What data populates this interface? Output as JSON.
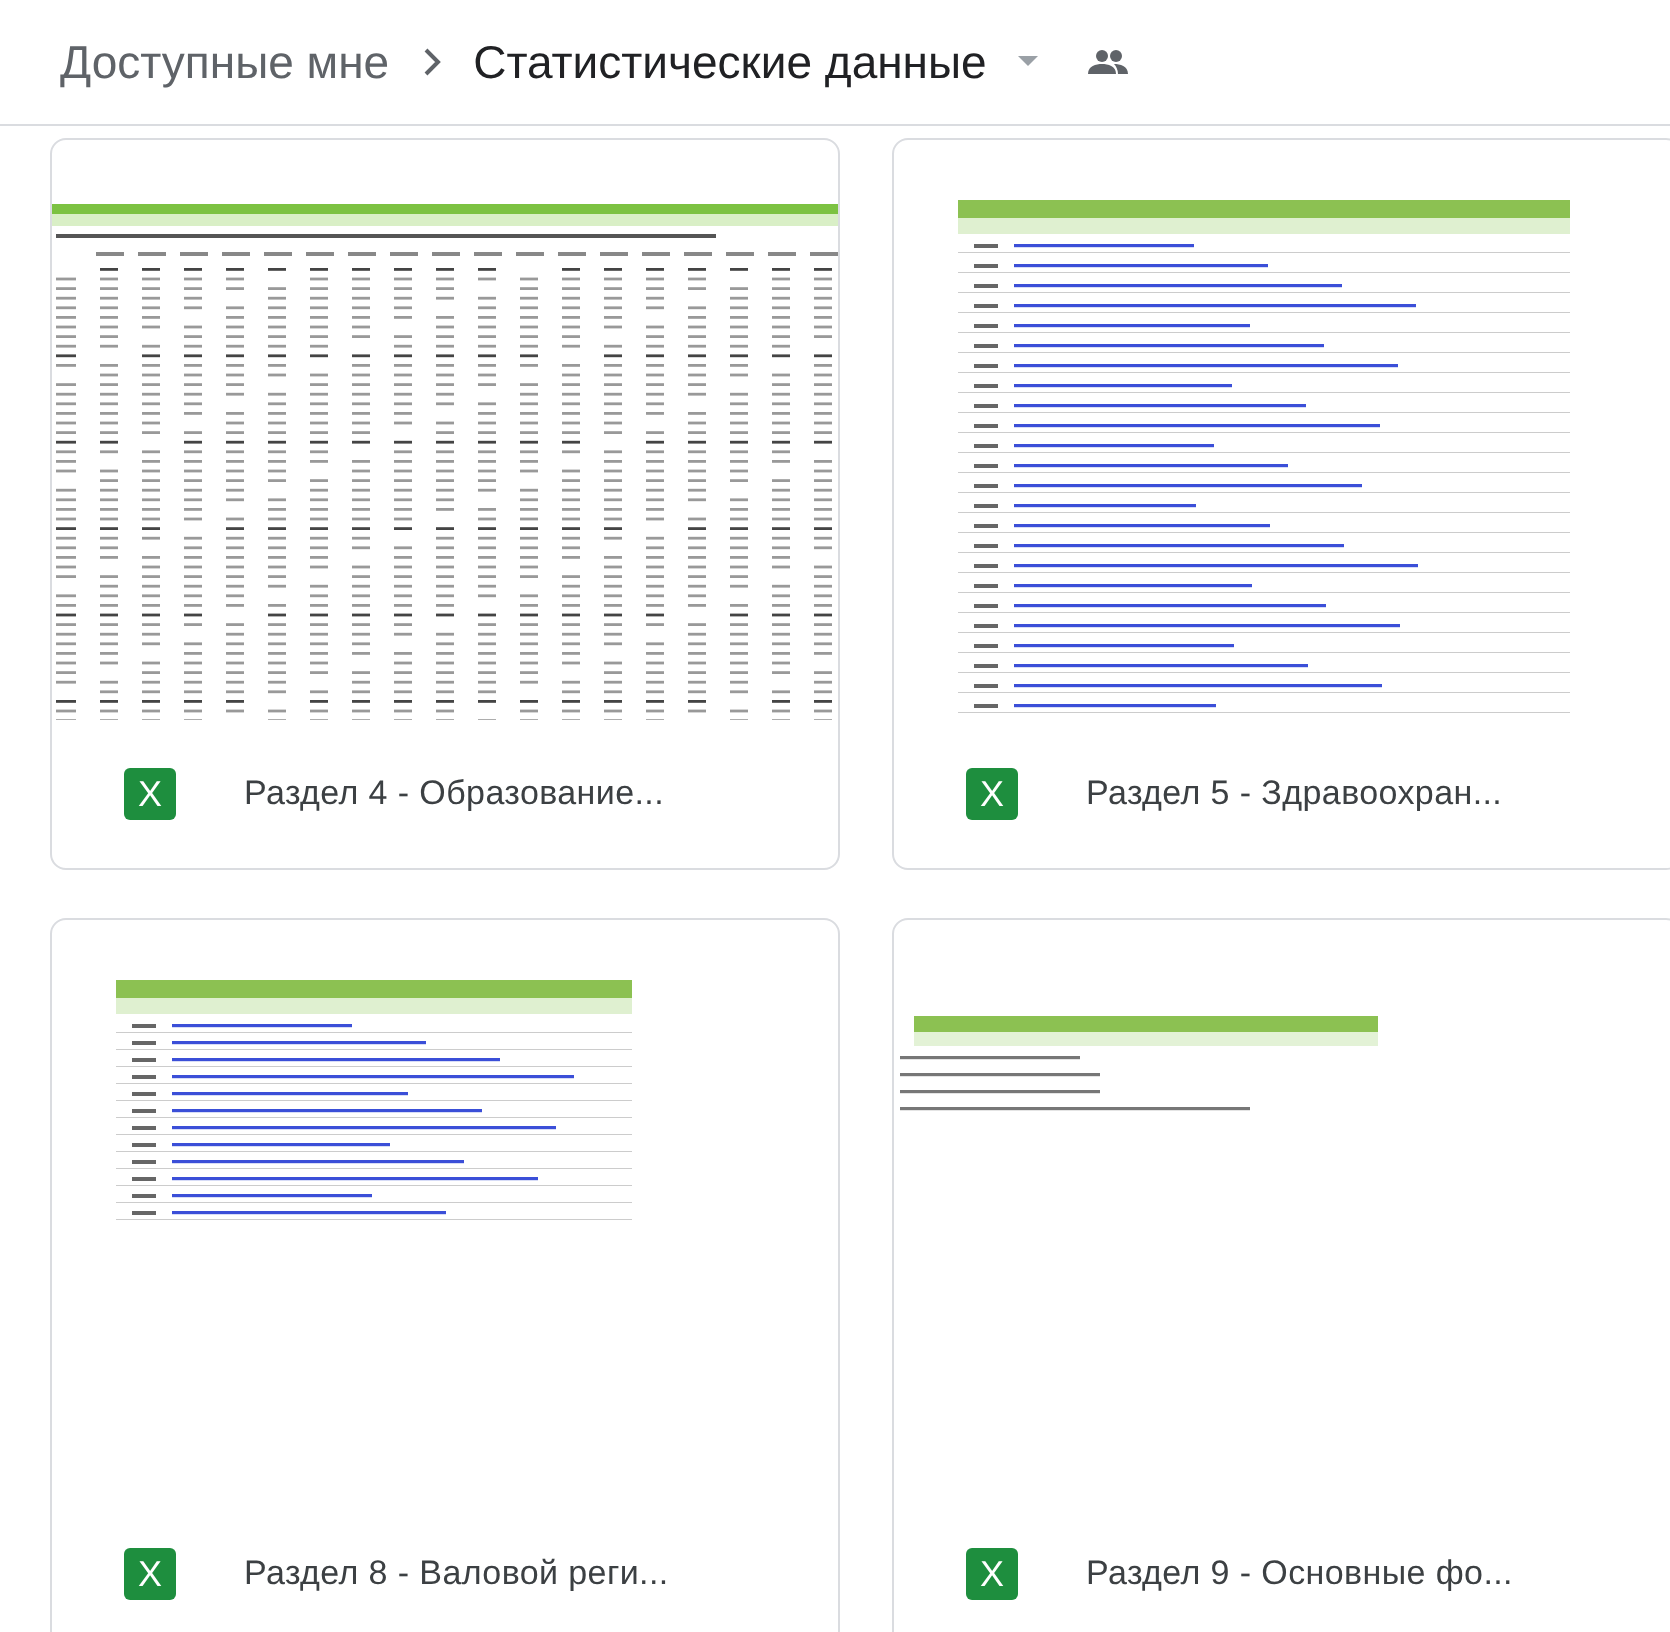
{
  "breadcrumb": [
    {
      "label": "Доступные мне",
      "current": false
    },
    {
      "label": "Статистические данные",
      "current": true
    }
  ],
  "files": [
    {
      "name": "Раздел 4 - Образование...",
      "icon_label": "X",
      "kind": "table"
    },
    {
      "name": "Раздел 5 - Здравоохран...",
      "icon_label": "X",
      "kind": "index"
    },
    {
      "name": "Раздел 8 - Валовой реги...",
      "icon_label": "X",
      "kind": "index_short"
    },
    {
      "name": "Раздел 9 - Основные фо...",
      "icon_label": "X",
      "kind": "list"
    }
  ]
}
